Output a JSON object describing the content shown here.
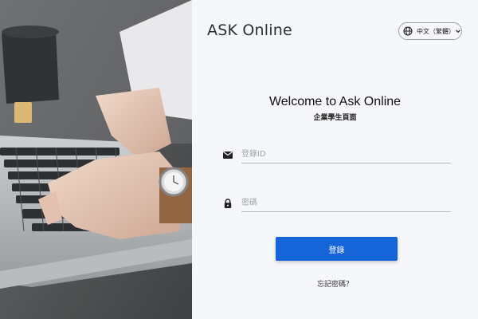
{
  "brand": {
    "title": "ASK Online"
  },
  "language": {
    "selected": "中文（繁體）",
    "icon": "globe-icon",
    "chevron": "chevron-down-icon"
  },
  "login": {
    "heading": "Welcome to Ask Online",
    "subheading": "企業學生頁面",
    "id_placeholder": "登錄ID",
    "id_icon": "mail-icon",
    "password_placeholder": "密碼",
    "password_icon": "lock-icon",
    "submit_label": "登錄",
    "forgot_label": "忘記密碼？"
  },
  "colors": {
    "accent": "#1565d8",
    "background": "#f6f7fa",
    "text": "#111111"
  }
}
